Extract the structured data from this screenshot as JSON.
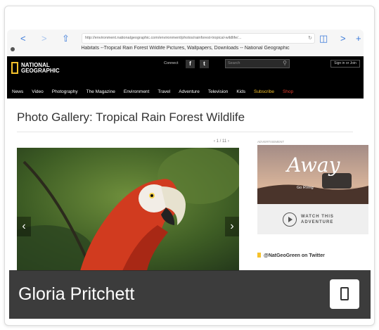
{
  "browser": {
    "url": "http://environment.nationalgeographic.com/environment/photos/rainforest-tropical-wildlife/...",
    "tab_title": "Habitats --Tropical Rain Forest Wildlife Pictures, Wallpapers, Downloads -- National Geographic",
    "back_glyph": "<",
    "forward_glyph": ">",
    "share_glyph": "⇧",
    "reload_glyph": "↻",
    "bookmarks_glyph": "◫",
    "tabs_glyph": ">",
    "new_tab_glyph": "+",
    "accent_color": "#3b7ad9"
  },
  "site": {
    "logo_text": "NATIONAL GEOGRAPHIC",
    "connect_label": "Connect",
    "facebook_glyph": "f",
    "twitter_glyph": "t",
    "search_placeholder": "Search",
    "search_glyph": "⚲",
    "signin_label": "Sign in or Join",
    "nav": [
      {
        "label": "News"
      },
      {
        "label": "Video"
      },
      {
        "label": "Photography"
      },
      {
        "label": "The Magazine"
      },
      {
        "label": "Environment"
      },
      {
        "label": "Travel"
      },
      {
        "label": "Adventure"
      },
      {
        "label": "Television"
      },
      {
        "label": "Kids"
      },
      {
        "label": "Subscribe"
      },
      {
        "label": "Shop"
      }
    ],
    "accent_color": "#f6c22c"
  },
  "page": {
    "title": "Photo Gallery: Tropical Rain Forest Wildlife",
    "pager": "‹ 1 / 11 ›",
    "prev_glyph": "‹",
    "next_glyph": "›",
    "sidebar_label": "ADVERTISEMENT",
    "ad": {
      "title": "Away",
      "subtitle": "Go RVing",
      "cta": "WATCH THIS ADVENTURE"
    },
    "twitter_heading": "@NatGeoGreen on Twitter"
  },
  "overlay": {
    "name": "Gloria Pritchett",
    "device_icon": "phone-icon"
  }
}
